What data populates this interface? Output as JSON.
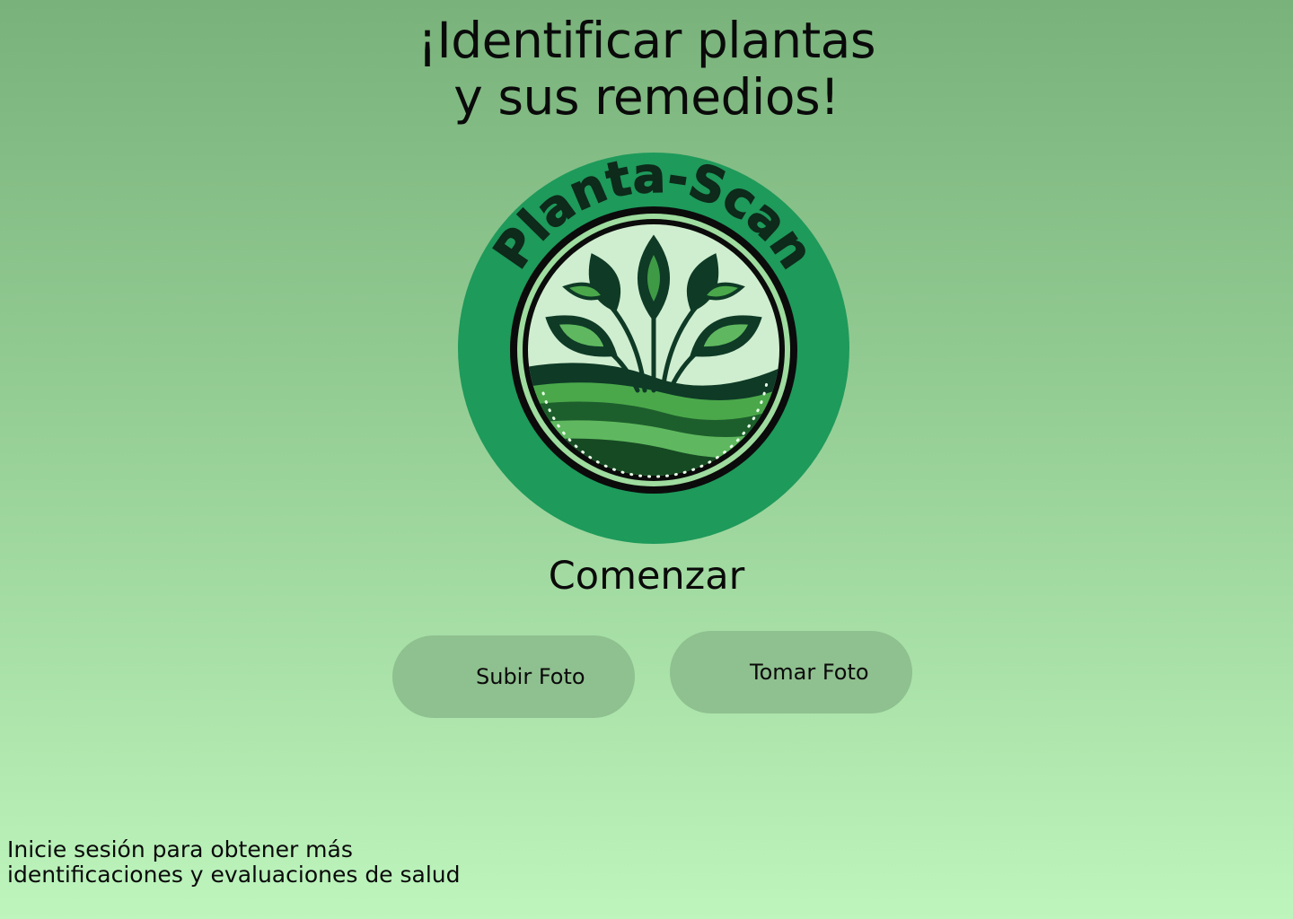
{
  "header": {
    "title_line1": "¡Identificar plantas",
    "title_line2": "y sus remedios!"
  },
  "logo": {
    "text": "Planta-Scan",
    "colors": {
      "disc": "#1e9a5b",
      "ring": "#0b0b0b",
      "inner": "#9fdc9f",
      "leaf_dark": "#0e3a26",
      "leaf_light": "#4aa84a",
      "field": "#2f7a2f"
    }
  },
  "main": {
    "start_label": "Comenzar",
    "buttons": {
      "upload": "Subir Foto",
      "camera": "Tomar Foto"
    }
  },
  "footer": {
    "login_line1": "Inicie sesión para obtener más",
    "login_line2": "identificaciones y evaluaciones de salud"
  },
  "colors": {
    "bg_top": "#79b27b",
    "bg_bottom": "#bdf5bd",
    "button_bg": "#8fc08f"
  }
}
